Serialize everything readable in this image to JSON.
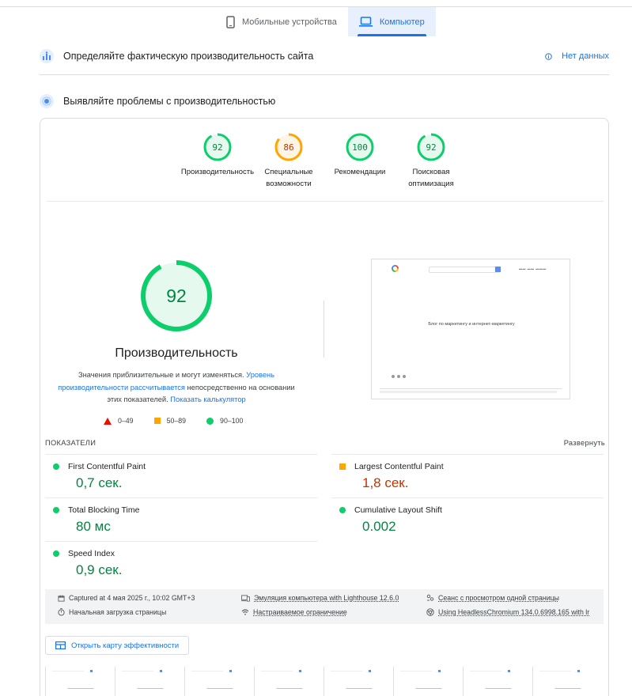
{
  "tabs": {
    "mobile": "Мобильные устройства",
    "desktop": "Компьютер"
  },
  "field_section": {
    "title": "Определяйте фактическую производительность сайта",
    "no_data": "Нет данных"
  },
  "lab_section": {
    "title": "Выявляйте проблемы с производительностью"
  },
  "categories": [
    {
      "score": "92",
      "label": "Производительность",
      "color": "#0cce6b",
      "text_color": "#018642",
      "fill": "#e6f9ee",
      "fraction": 0.92
    },
    {
      "score": "86",
      "label": "Специальные возможности",
      "color": "#ffa400",
      "text_color": "#c33300",
      "fill": "#fff5e5",
      "fraction": 0.86
    },
    {
      "score": "100",
      "label": "Рекомендации",
      "color": "#0cce6b",
      "text_color": "#018642",
      "fill": "#e6f9ee",
      "fraction": 1.0
    },
    {
      "score": "92",
      "label": "Поисковая оптимизация",
      "color": "#0cce6b",
      "text_color": "#018642",
      "fill": "#e6f9ee",
      "fraction": 0.92
    }
  ],
  "performance": {
    "score": "92",
    "fraction": 0.92,
    "title": "Производительность",
    "desc_part1": "Значения приблизительные и могут изменяться. ",
    "desc_link1": "Уровень производительности рассчитывается",
    "desc_part2": " непосредственно на основании этих показателей. ",
    "desc_link2": "Показать калькулятор"
  },
  "legend": {
    "poor": "0–49",
    "average": "50–89",
    "good": "90–100"
  },
  "screenshot": {
    "headline": "Блог по маркетингу и интернет-маркетингу"
  },
  "metrics": {
    "header": "ПОКАЗАТЕЛИ",
    "expand": "Развернуть",
    "fcp": {
      "name": "First Contentful Paint",
      "value": "0,7 сек."
    },
    "lcp": {
      "name": "Largest Contentful Paint",
      "value": "1,8 сек."
    },
    "tbt": {
      "name": "Total Blocking Time",
      "value": "80 мс"
    },
    "cls": {
      "name": "Cumulative Layout Shift",
      "value": "0.002"
    },
    "si": {
      "name": "Speed Index",
      "value": "0,9 сек."
    }
  },
  "info": {
    "captured": "Captured at 4 мая 2025 г., 10:02 GMT+3",
    "emulation": "Эмуляция компьютера with Lighthouse 12.6.0",
    "session": "Сеанс с просмотром одной страницы",
    "initial_load": "Начальная загрузка страницы",
    "throttling": "Настраиваемое ограничение",
    "browser": "Using HeadlessChromium 134.0.6998.165 with lr"
  },
  "treemap_button": "Открыть карту эффективности",
  "colors": {
    "accent": "#1a73e8",
    "good": "#0cce6b",
    "average": "#ffa400",
    "poor": "#eb0f00"
  }
}
